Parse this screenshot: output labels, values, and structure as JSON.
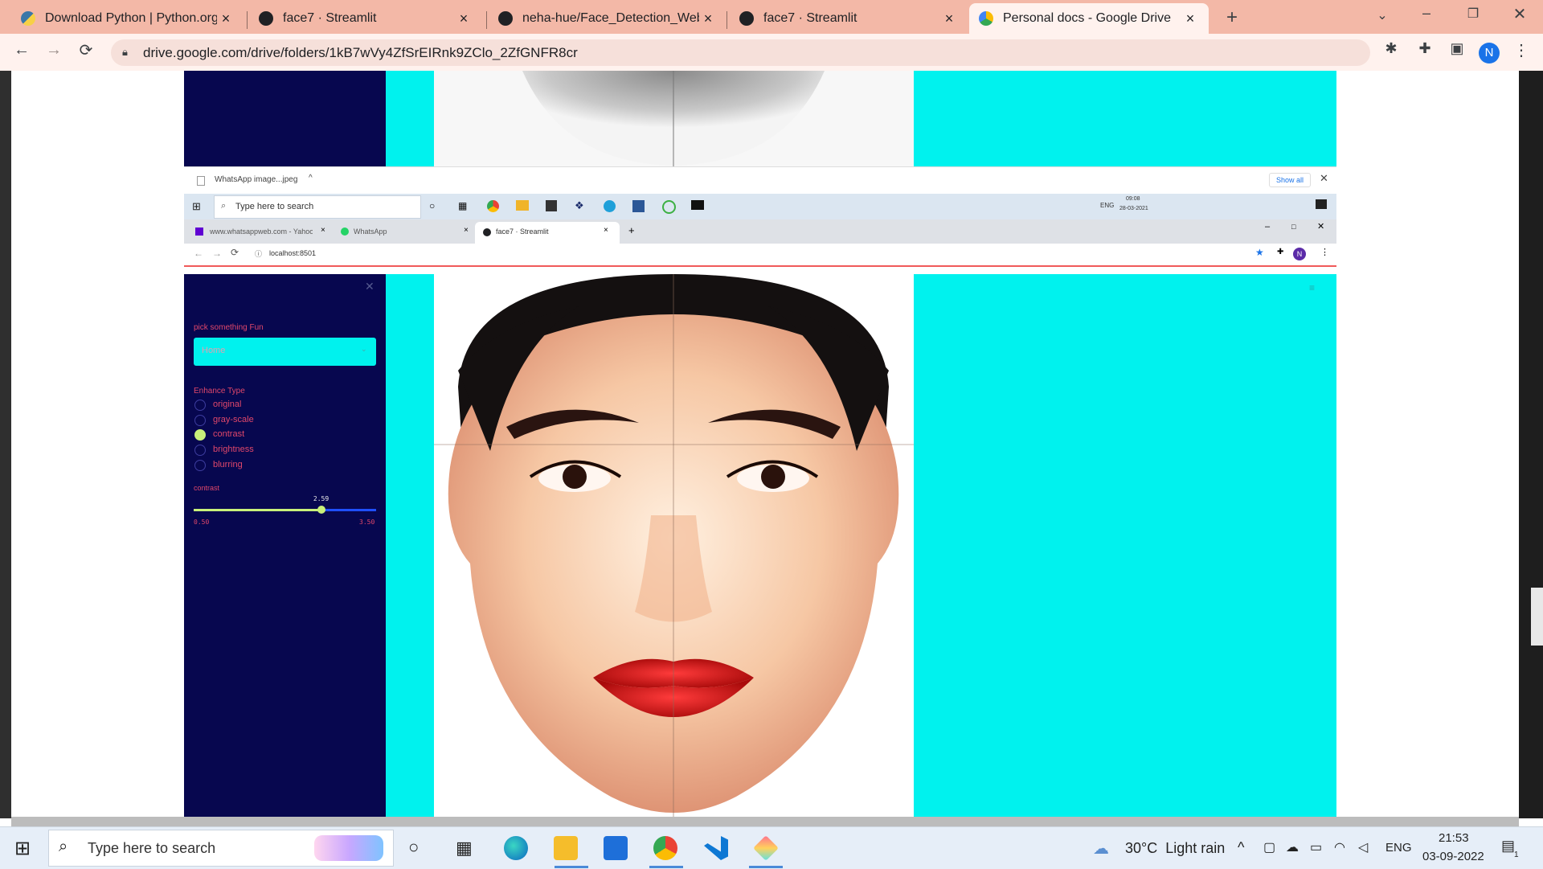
{
  "browser": {
    "tabs": [
      {
        "title": "Download Python | Python.org",
        "icon": "python-icon",
        "active": false
      },
      {
        "title": "face7 · Streamlit",
        "icon": "streamlit-icon",
        "active": false
      },
      {
        "title": "neha-hue/Face_Detection_WebA",
        "icon": "github-icon",
        "active": false
      },
      {
        "title": "face7 · Streamlit",
        "icon": "streamlit-icon",
        "active": false
      },
      {
        "title": "Personal docs - Google Drive",
        "icon": "google-drive-icon",
        "active": true
      }
    ],
    "close_glyph": "×",
    "new_tab": "+",
    "url": "drive.google.com/drive/folders/1kB7wVy4ZfSrEIRnk9ZClo_2ZfGNFR8cr",
    "profile_initial": "N"
  },
  "inner": {
    "download_file": "WhatsApp image...jpeg",
    "show_all": "Show all",
    "taskbar_search": "Type here to search",
    "tray_lang": "ENG",
    "tray_time": "09:08",
    "tray_date": "28-03-2021",
    "tabs": [
      {
        "title": "www.whatsappweb.com - Yahoo"
      },
      {
        "title": "WhatsApp"
      },
      {
        "title": "face7 · Streamlit"
      }
    ],
    "url": "localhost:8501",
    "profile_initial": "N",
    "sidebar": {
      "select_label": "pick something Fun",
      "select_value": "Home",
      "enhance_label": "Enhance Type",
      "options": [
        "original",
        "gray-scale",
        "contrast",
        "brightness",
        "blurring"
      ],
      "selected_option": "contrast",
      "slider_label": "contrast",
      "slider_value": "2.59",
      "slider_min": "0.50",
      "slider_max": "3.50",
      "slider_fraction": 0.7
    }
  },
  "windows_taskbar": {
    "search_placeholder": "Type here to search",
    "weather": "30°C  Light rain",
    "lang": "ENG",
    "time": "21:53",
    "date": "03-09-2022",
    "notifications": "1"
  },
  "colors": {
    "accent_cyan": "#00f2ee",
    "sidebar_navy": "#07074f",
    "streamlit_red": "#e0476a"
  }
}
